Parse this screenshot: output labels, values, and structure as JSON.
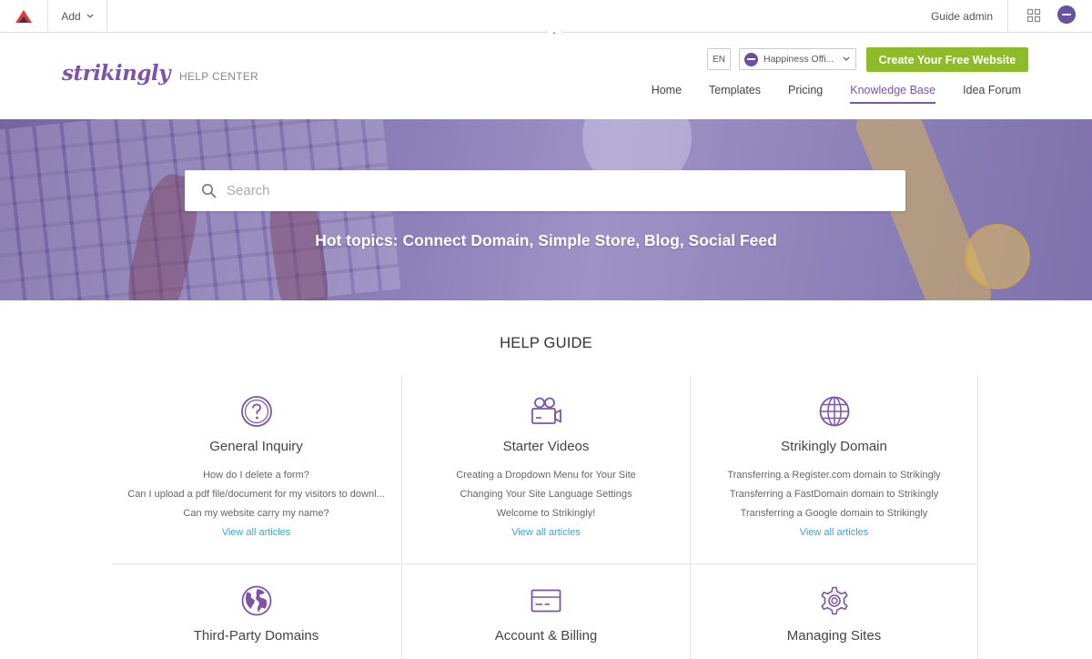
{
  "adminbar": {
    "add_label": "Add",
    "admin_name": "Guide admin"
  },
  "header": {
    "brand_wordmark": "strikingly",
    "brand_sub": "HELP CENTER",
    "language": "EN",
    "account_name": "Happiness Offi...",
    "cta_label": "Create Your Free Website",
    "nav": [
      {
        "label": "Home"
      },
      {
        "label": "Templates"
      },
      {
        "label": "Pricing"
      },
      {
        "label": "Knowledge Base",
        "active": true
      },
      {
        "label": "Idea Forum"
      }
    ]
  },
  "hero": {
    "search_placeholder": "Search",
    "hot_topics": "Hot topics: Connect Domain, Simple Store, Blog, Social Feed"
  },
  "guide": {
    "title": "HELP GUIDE",
    "categories": [
      {
        "icon": "question-circle-icon",
        "title": "General Inquiry",
        "articles": [
          "How do I delete a form?",
          "Can I upload a pdf file/document for my visitors to downl...",
          "Can my website carry my name?"
        ],
        "more": "View all articles"
      },
      {
        "icon": "video-camera-icon",
        "title": "Starter Videos",
        "articles": [
          "Creating a Dropdown Menu for Your Site",
          "Changing Your Site Language Settings",
          "Welcome to Strikingly!"
        ],
        "more": "View all articles"
      },
      {
        "icon": "globe-icon",
        "title": "Strikingly Domain",
        "articles": [
          "Transferring a Register.com domain to Strikingly",
          "Transferring a FastDomain domain to Strikingly",
          "Transferring a Google domain to Strikingly"
        ],
        "more": "View all articles"
      },
      {
        "icon": "earth-icon",
        "title": "Third-Party Domains"
      },
      {
        "icon": "credit-card-icon",
        "title": "Account & Billing"
      },
      {
        "icon": "gear-icon",
        "title": "Managing Sites"
      }
    ]
  },
  "colors": {
    "brand_purple": "#7d54a8",
    "cta_green": "#8dbb2a",
    "link_blue": "#3fa3cf"
  }
}
